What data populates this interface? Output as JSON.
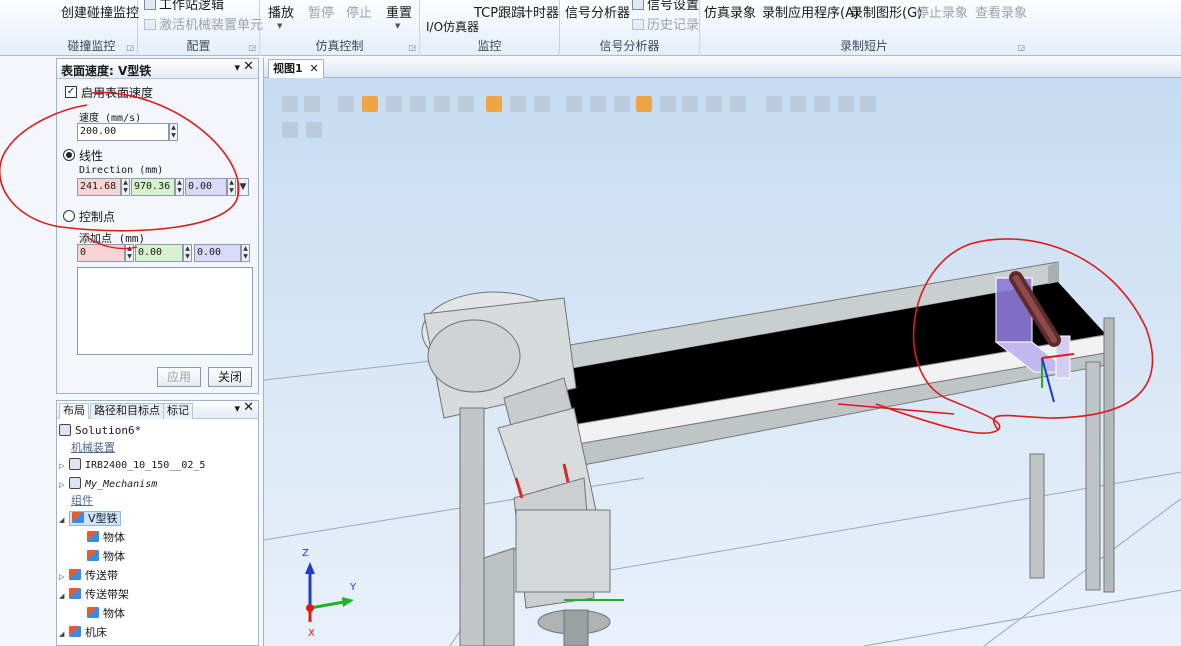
{
  "ribbon": {
    "groups": {
      "collision": {
        "label": "碰撞监控",
        "create_collision_monitor": "创建碰撞监控"
      },
      "config": {
        "label": "配置",
        "station_logic": "工作站逻辑",
        "activate_mechanism_unit": "激活机械装置单元"
      },
      "sim_control": {
        "label": "仿真控制",
        "play": "播放",
        "pause": "暂停",
        "stop": "停止",
        "reset": "重置"
      },
      "monitor": {
        "label": "监控",
        "io_sim": "I/O仿真器",
        "tcp_trace": "TCP跟踪",
        "timer": "计时器"
      },
      "signal_analyzer": {
        "label": "信号分析器",
        "signal_analyzer": "信号分析器",
        "signal_settings": "信号设置",
        "history": "历史记录"
      },
      "record": {
        "label": "录制短片",
        "sim_record": "仿真录象",
        "record_app": "录制应用程序(A)",
        "record_graphics": "录制图形(G)",
        "stop_record": "停止录象",
        "view_record": "查看录象"
      }
    }
  },
  "surface_panel": {
    "title": "表面速度: V型铁",
    "enable_label": "启用表面速度",
    "enable_checked": true,
    "speed_label": "速度 (mm/s)",
    "speed_value": "200.00",
    "linear_label": "线性",
    "linear_selected": true,
    "direction_label": "Direction (mm)",
    "direction": [
      "241.68",
      "970.36",
      "0.00"
    ],
    "control_points_label": "控制点",
    "add_point_label": "添加点 (mm)",
    "add_point": [
      "0",
      "0.00",
      "0.00"
    ],
    "apply_label": "应用",
    "close_label": "关闭"
  },
  "layout_panel": {
    "tabs": [
      "布局",
      "路径和目标点",
      "标记"
    ],
    "tree": {
      "solution": "Solution6*",
      "mechanisms_cat": "机械装置",
      "robot": "IRB2400_10_150__02_5",
      "my_mech": "My_Mechanism",
      "components_cat": "组件",
      "v_iron": "V型铁",
      "v_iron_child1": "物体",
      "v_iron_child2": "物体",
      "conveyor": "传送带",
      "conveyor_frame": "传送带架",
      "conveyor_frame_child": "物体",
      "machine": "机床"
    }
  },
  "view": {
    "tab_label": "视图1",
    "axis_z": "Z",
    "axis_y": "Y",
    "axis_x": "X"
  }
}
